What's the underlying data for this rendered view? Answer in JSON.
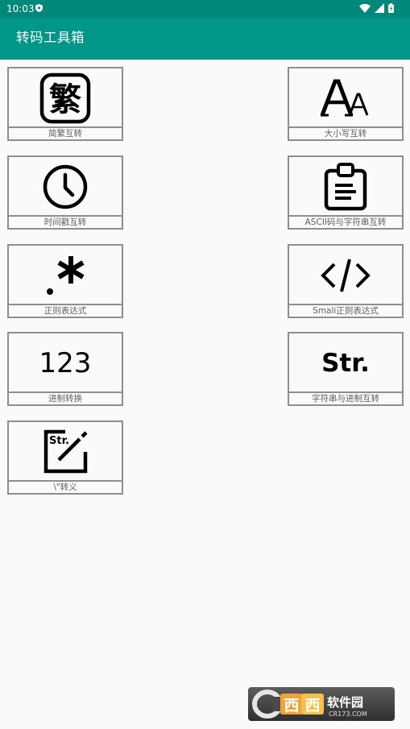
{
  "status_bar": {
    "time": "10:03",
    "bg_color": "#00897b",
    "icons": [
      "shield-icon",
      "wifi-icon",
      "signal-icon",
      "battery-icon"
    ]
  },
  "app_bar": {
    "title": "转码工具箱",
    "bg_color": "#009688"
  },
  "tools": [
    {
      "label": "简繁互转",
      "icon": "traditional-char-icon",
      "glyph": "繁"
    },
    {
      "label": "大小写互转",
      "icon": "font-case-icon"
    },
    {
      "label": "时间戳互转",
      "icon": "clock-icon"
    },
    {
      "label": "ASCII码与字符串互转",
      "icon": "clipboard-icon"
    },
    {
      "label": "正则表达式",
      "icon": "regex-icon"
    },
    {
      "label": "Smali正则表达式",
      "icon": "code-icon"
    },
    {
      "label": "进制转换",
      "icon": "numbers-icon",
      "glyph": "123"
    },
    {
      "label": "字符串与进制互转",
      "icon": "str-icon",
      "glyph": "Str."
    },
    {
      "label": "\\\"转义",
      "icon": "str-edit-icon",
      "glyph": "Str."
    }
  ],
  "watermark": {
    "text": "西西软件园",
    "sub": "CR173.COM"
  }
}
